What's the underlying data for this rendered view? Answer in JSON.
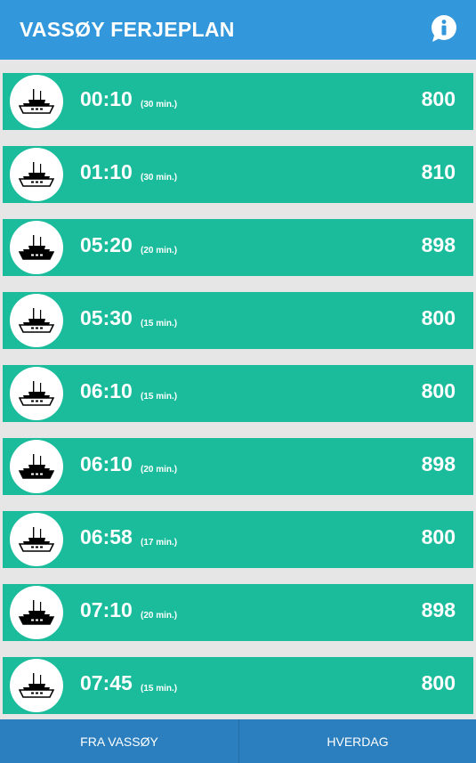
{
  "header": {
    "title": "VASSØY FERJEPLAN",
    "info_icon": "info-icon"
  },
  "departures": [
    {
      "time": "00:10",
      "duration": "(30 min.)",
      "route": "800",
      "ferry": "outline"
    },
    {
      "time": "01:10",
      "duration": "(30 min.)",
      "route": "810",
      "ferry": "outline"
    },
    {
      "time": "05:20",
      "duration": "(20 min.)",
      "route": "898",
      "ferry": "solid"
    },
    {
      "time": "05:30",
      "duration": "(15 min.)",
      "route": "800",
      "ferry": "outline"
    },
    {
      "time": "06:10",
      "duration": "(15 min.)",
      "route": "800",
      "ferry": "outline"
    },
    {
      "time": "06:10",
      "duration": "(20 min.)",
      "route": "898",
      "ferry": "solid"
    },
    {
      "time": "06:58",
      "duration": "(17 min.)",
      "route": "800",
      "ferry": "outline"
    },
    {
      "time": "07:10",
      "duration": "(20 min.)",
      "route": "898",
      "ferry": "solid"
    },
    {
      "time": "07:45",
      "duration": "(15 min.)",
      "route": "800",
      "ferry": "outline"
    }
  ],
  "footer": {
    "direction_label": "FRA VASSØY",
    "day_label": "HVERDAG"
  },
  "colors": {
    "header": "#3398db",
    "row": "#1abc9c",
    "footer": "#2c7fbf",
    "background": "#e6e6e6"
  }
}
